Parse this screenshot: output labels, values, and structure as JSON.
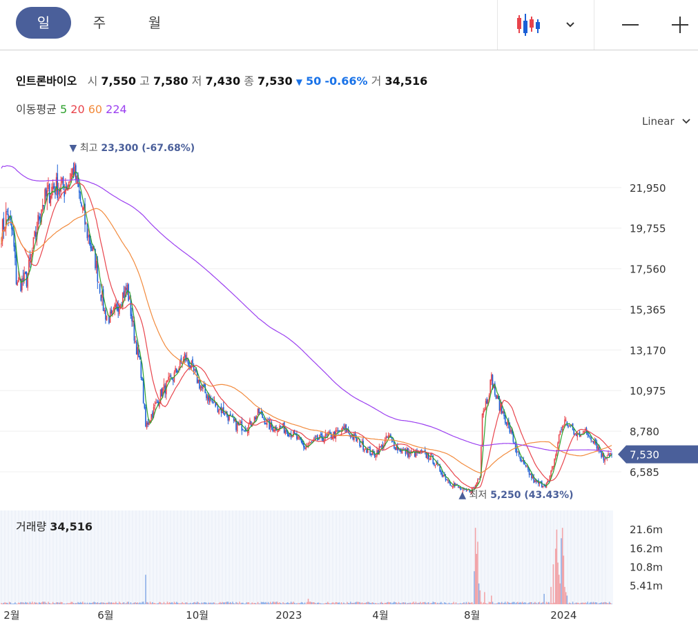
{
  "toolbar": {
    "periods": [
      {
        "label": "일",
        "active": true
      },
      {
        "label": "주",
        "active": false
      },
      {
        "label": "월",
        "active": false
      }
    ],
    "chart_type_icon": "candlestick-icon",
    "dropdown_icon": "chevron-down-icon",
    "zoom_out_icon": "minus-icon",
    "zoom_in_icon": "plus-icon"
  },
  "stock": {
    "name": "인트론바이오",
    "open_label": "시",
    "open": "7,550",
    "high_label": "고",
    "high": "7,580",
    "low_label": "저",
    "low": "7,430",
    "close_label": "종",
    "close": "7,530",
    "change_arrow": "▼",
    "change": "50",
    "change_pct": "-0.66%",
    "volume_label": "거",
    "volume": "34,516"
  },
  "moving_average": {
    "label": "이동평균",
    "periods": [
      {
        "value": "5",
        "color": "#2ca02c"
      },
      {
        "value": "20",
        "color": "#e8434b"
      },
      {
        "value": "60",
        "color": "#f28a3c"
      },
      {
        "value": "224",
        "color": "#9b3ff0"
      }
    ]
  },
  "scale_mode": "Linear",
  "colors": {
    "up": "#e8434b",
    "down": "#1a5fd6",
    "accent": "#4a5f9a"
  },
  "chart_data": {
    "type": "candlestick",
    "y_ticks": [
      "21,950",
      "19,755",
      "17,560",
      "15,365",
      "13,170",
      "10,975",
      "8,780",
      "6,585"
    ],
    "y_tick_values": [
      21950,
      19755,
      17560,
      15365,
      13170,
      10975,
      8780,
      6585
    ],
    "ylim": [
      4645,
      25000
    ],
    "x_ticks": [
      "2월",
      "6월",
      "10월",
      "2023",
      "4월",
      "8월",
      "2024"
    ],
    "x_tick_index": [
      9,
      91,
      171,
      251,
      331,
      411,
      491
    ],
    "current_price_label": "7,530",
    "current_price": 7530,
    "high_annotation": {
      "arrow": "▼",
      "label": "최고",
      "value": "23,300 (-67.68%)",
      "price": 23300,
      "index": 63
    },
    "low_annotation": {
      "arrow": "▲",
      "label": "최저",
      "value": "5,250 (43.43%)",
      "price": 5250,
      "index": 403
    },
    "close_keypoints": [
      [
        0,
        19500
      ],
      [
        5,
        20600
      ],
      [
        10,
        19400
      ],
      [
        13,
        17000
      ],
      [
        17,
        16800
      ],
      [
        22,
        17000
      ],
      [
        28,
        18800
      ],
      [
        35,
        21000
      ],
      [
        45,
        22000
      ],
      [
        55,
        21900
      ],
      [
        60,
        22500
      ],
      [
        63,
        23000
      ],
      [
        68,
        21500
      ],
      [
        75,
        19500
      ],
      [
        82,
        18000
      ],
      [
        90,
        15200
      ],
      [
        96,
        14800
      ],
      [
        104,
        16000
      ],
      [
        110,
        16500
      ],
      [
        116,
        14000
      ],
      [
        122,
        12000
      ],
      [
        126,
        9000
      ],
      [
        132,
        9800
      ],
      [
        140,
        10900
      ],
      [
        150,
        11700
      ],
      [
        160,
        12800
      ],
      [
        166,
        12200
      ],
      [
        175,
        11100
      ],
      [
        185,
        10300
      ],
      [
        195,
        9800
      ],
      [
        205,
        9100
      ],
      [
        215,
        9000
      ],
      [
        225,
        9800
      ],
      [
        235,
        9000
      ],
      [
        245,
        9000
      ],
      [
        255,
        8600
      ],
      [
        265,
        7900
      ],
      [
        275,
        8300
      ],
      [
        285,
        8500
      ],
      [
        295,
        8700
      ],
      [
        300,
        8900
      ],
      [
        310,
        8300
      ],
      [
        318,
        7900
      ],
      [
        325,
        7500
      ],
      [
        333,
        8000
      ],
      [
        338,
        8500
      ],
      [
        345,
        7900
      ],
      [
        355,
        7600
      ],
      [
        365,
        7600
      ],
      [
        375,
        7400
      ],
      [
        385,
        6500
      ],
      [
        392,
        6000
      ],
      [
        400,
        5700
      ],
      [
        405,
        5500
      ],
      [
        413,
        5700
      ],
      [
        418,
        6500
      ],
      [
        420,
        9800
      ],
      [
        424,
        10500
      ],
      [
        428,
        11600
      ],
      [
        432,
        10600
      ],
      [
        440,
        9500
      ],
      [
        446,
        8500
      ],
      [
        452,
        7300
      ],
      [
        460,
        6600
      ],
      [
        466,
        6000
      ],
      [
        472,
        5900
      ],
      [
        478,
        6000
      ],
      [
        484,
        7500
      ],
      [
        488,
        8800
      ],
      [
        492,
        9300
      ],
      [
        497,
        9000
      ],
      [
        502,
        8500
      ],
      [
        507,
        8800
      ],
      [
        513,
        8600
      ],
      [
        518,
        8300
      ],
      [
        522,
        7800
      ],
      [
        526,
        7300
      ],
      [
        530,
        7600
      ],
      [
        533,
        7530
      ]
    ],
    "ma_periods": [
      5,
      20,
      60,
      224
    ],
    "volume": {
      "label": "거래량",
      "value": "34,516",
      "y_ticks": [
        "21.6m",
        "16.2m",
        "10.8m",
        "5.41m"
      ],
      "y_tick_values": [
        21.6,
        16.2,
        10.8,
        5.41
      ],
      "ylim": [
        0,
        27
      ],
      "spikes": [
        [
          126,
          8.5
        ],
        [
          268,
          1.6
        ],
        [
          413,
          9.5
        ],
        [
          414,
          22.0
        ],
        [
          415,
          14.5
        ],
        [
          416,
          18.0
        ],
        [
          417,
          6.0
        ],
        [
          418,
          4.0
        ],
        [
          422,
          3.5
        ],
        [
          428,
          2.5
        ],
        [
          474,
          3.0
        ],
        [
          480,
          5.0
        ],
        [
          482,
          11.5
        ],
        [
          484,
          16.0
        ],
        [
          485,
          21.5
        ],
        [
          486,
          12.0
        ],
        [
          487,
          8.5
        ],
        [
          488,
          6.0
        ],
        [
          489,
          19.0
        ],
        [
          490,
          22.0
        ],
        [
          491,
          14.0
        ],
        [
          492,
          5.0
        ],
        [
          493,
          3.5
        ],
        [
          494,
          2.5
        ]
      ]
    }
  }
}
